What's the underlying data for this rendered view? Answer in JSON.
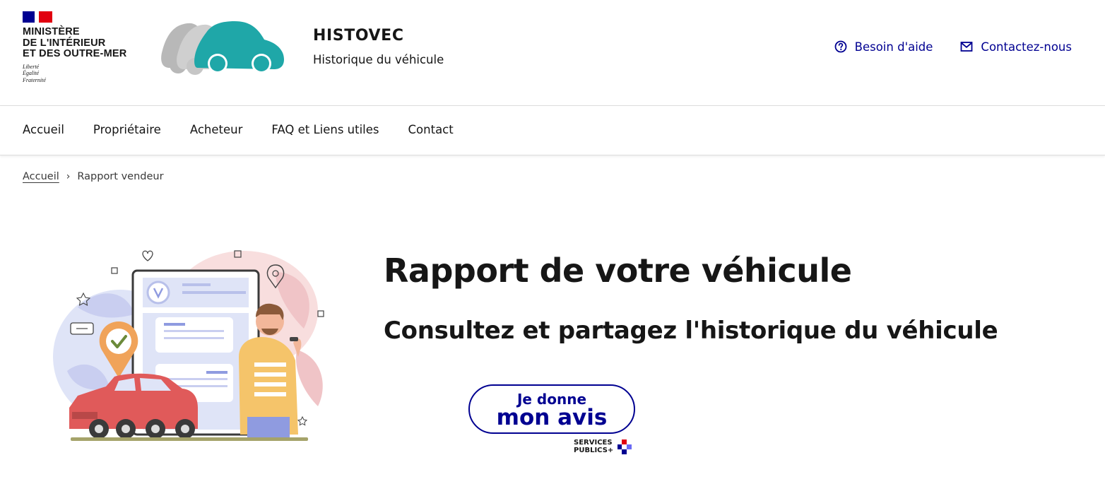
{
  "header": {
    "ministry_lines": [
      "Ministère",
      "de l'intérieur",
      "et des outre-mer"
    ],
    "motto": [
      "Liberté",
      "Égalité",
      "Fraternité"
    ],
    "service_title": "HISTOVEC",
    "service_tagline": "Historique du véhicule",
    "tools": [
      {
        "label": "Besoin d'aide",
        "icon": "question-circle-icon"
      },
      {
        "label": "Contactez-nous",
        "icon": "mail-icon"
      }
    ],
    "colors": {
      "brand_blue": "#000091",
      "marianne_red": "#e1000f",
      "logo_teal": "#1fa7a8",
      "logo_grey": "#b8b8b8"
    }
  },
  "nav": {
    "items": [
      "Accueil",
      "Propriétaire",
      "Acheteur",
      "FAQ et Liens utiles",
      "Contact"
    ]
  },
  "breadcrumb": {
    "home": "Accueil",
    "separator": "›",
    "current": "Rapport vendeur"
  },
  "hero": {
    "title": "Rapport de votre véhicule",
    "subtitle": "Consultez et partagez l'historique du véhicule",
    "illustration_icon": "seller-report-illustration"
  },
  "feedback": {
    "line1": "Je donne",
    "line2": "mon avis",
    "badge_line1": "SERVICES",
    "badge_line2": "PUBLICS+"
  }
}
